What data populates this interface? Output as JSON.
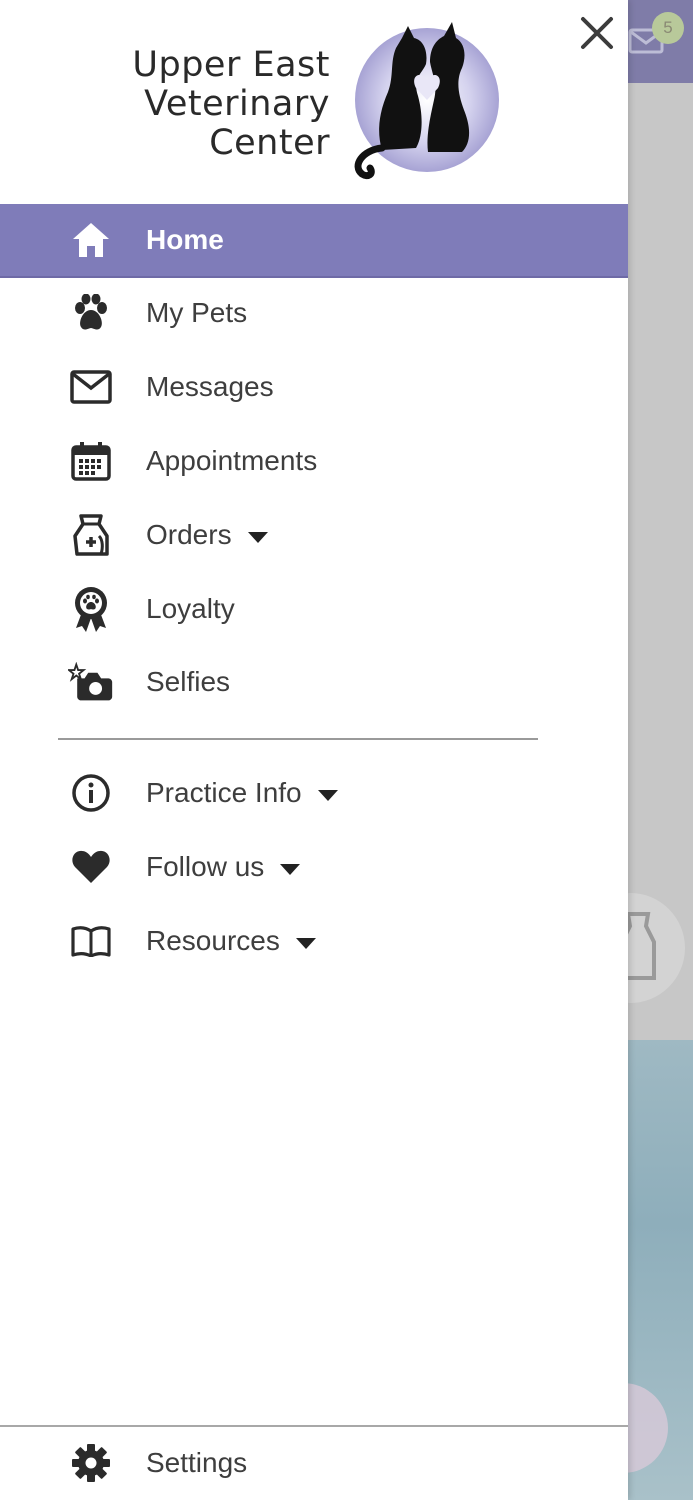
{
  "background": {
    "mail_badge_count": "5",
    "accent_color": "#7f7ca8"
  },
  "drawer": {
    "logo": {
      "line1": "Upper East",
      "line2": "Veterinary",
      "line3": "Center"
    },
    "close_icon": "close-icon",
    "menu": {
      "home": "Home",
      "my_pets": "My Pets",
      "messages": "Messages",
      "appointments": "Appointments",
      "orders": "Orders",
      "loyalty": "Loyalty",
      "selfies": "Selfies",
      "practice_info": "Practice Info",
      "follow_us": "Follow us",
      "resources": "Resources"
    },
    "settings": "Settings",
    "active_color": "#7f7cb9"
  }
}
